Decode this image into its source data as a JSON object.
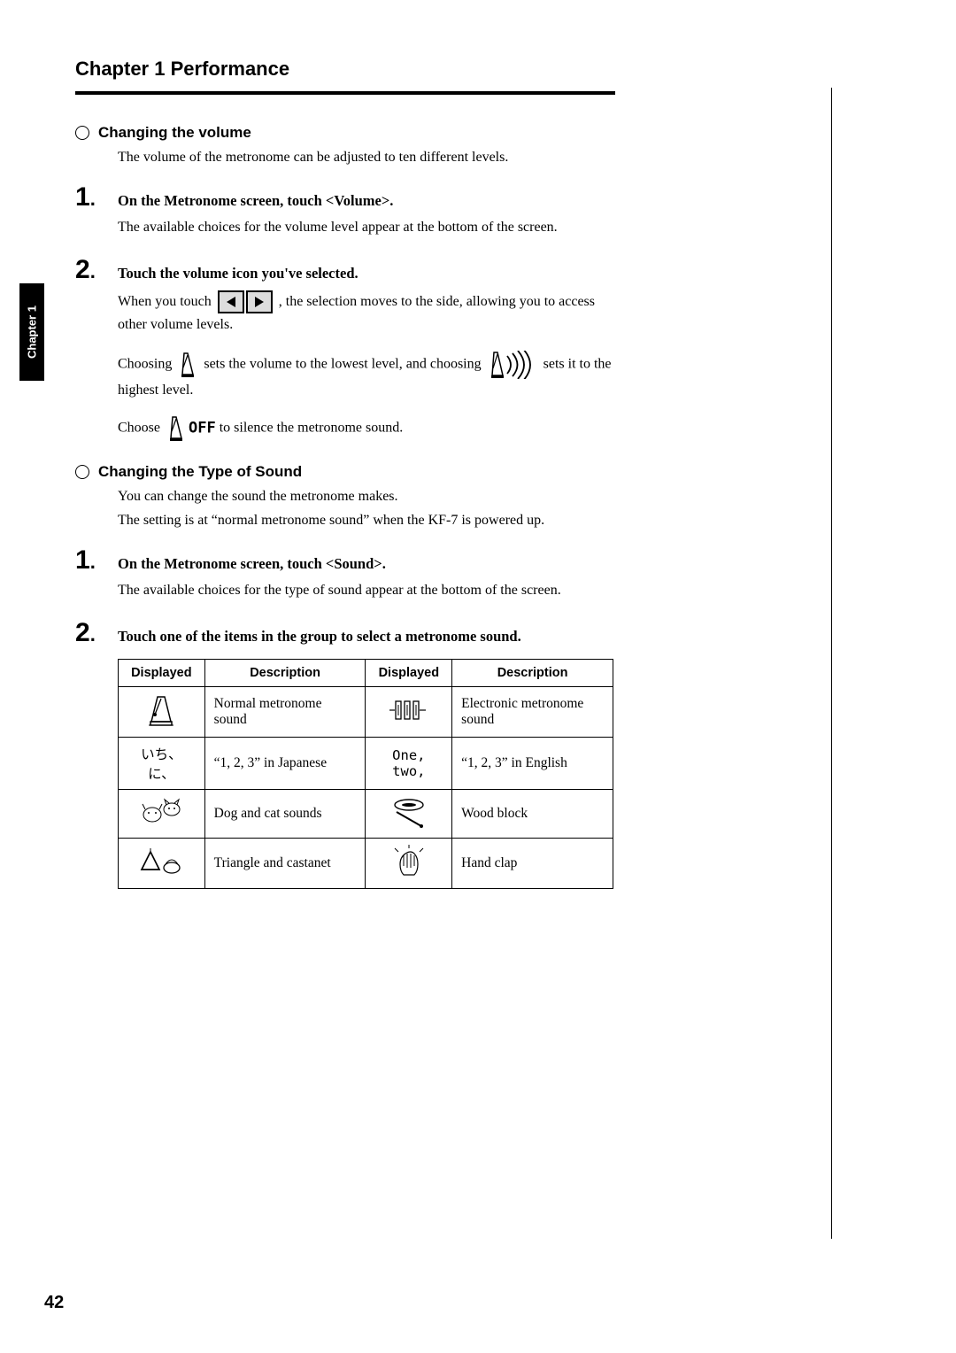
{
  "chapter_tab": "Chapter 1",
  "chapter_heading": "Chapter 1 Performance",
  "page_number": "42",
  "section1": {
    "heading": "Changing the volume",
    "intro": "The volume of the metronome can be adjusted to ten different levels.",
    "step1_title": "On the Metronome screen, touch <Volume>.",
    "step1_desc": "The available choices for the volume level appear at the bottom of the screen.",
    "step2_title": "Touch the volume icon you've selected.",
    "touch_pre": "When you touch ",
    "touch_post": ", the selection moves to the side, allowing you to access other volume levels.",
    "choose_pre": "Choosing ",
    "choose_mid": " sets the volume to the lowest level, and choosing ",
    "choose_post": " sets it to the highest level.",
    "off_pre": "Choose ",
    "off_label": "OFF",
    "off_post": " to silence the metronome sound."
  },
  "section2": {
    "heading": "Changing the Type of Sound",
    "intro1": "You can change the sound the metronome makes.",
    "intro2": "The setting is at “normal metronome sound” when the KF-7 is powered up.",
    "step1_title": "On the Metronome screen, touch <Sound>.",
    "step1_desc": "The available choices for the type of sound appear at the bottom of the screen.",
    "step2_title": "Touch one of the items in the group to select a metronome sound.",
    "table": {
      "h1": "Displayed",
      "h2": "Description",
      "h3": "Displayed",
      "h4": "Description",
      "rows": [
        {
          "icon1": "metronome",
          "desc1": "Normal metronome sound",
          "icon2": "electronic",
          "desc2": "Electronic metronome sound"
        },
        {
          "icon1": "いち、に、",
          "desc1": "“1, 2, 3” in Japanese",
          "icon2": "One,\ntwo,",
          "desc2": "“1, 2, 3” in English"
        },
        {
          "icon1": "dogcat",
          "desc1": "Dog and cat sounds",
          "icon2": "wood",
          "desc2": "Wood block"
        },
        {
          "icon1": "triangle",
          "desc1": "Triangle and castanet",
          "icon2": "handclap",
          "desc2": "Hand clap"
        }
      ]
    }
  }
}
